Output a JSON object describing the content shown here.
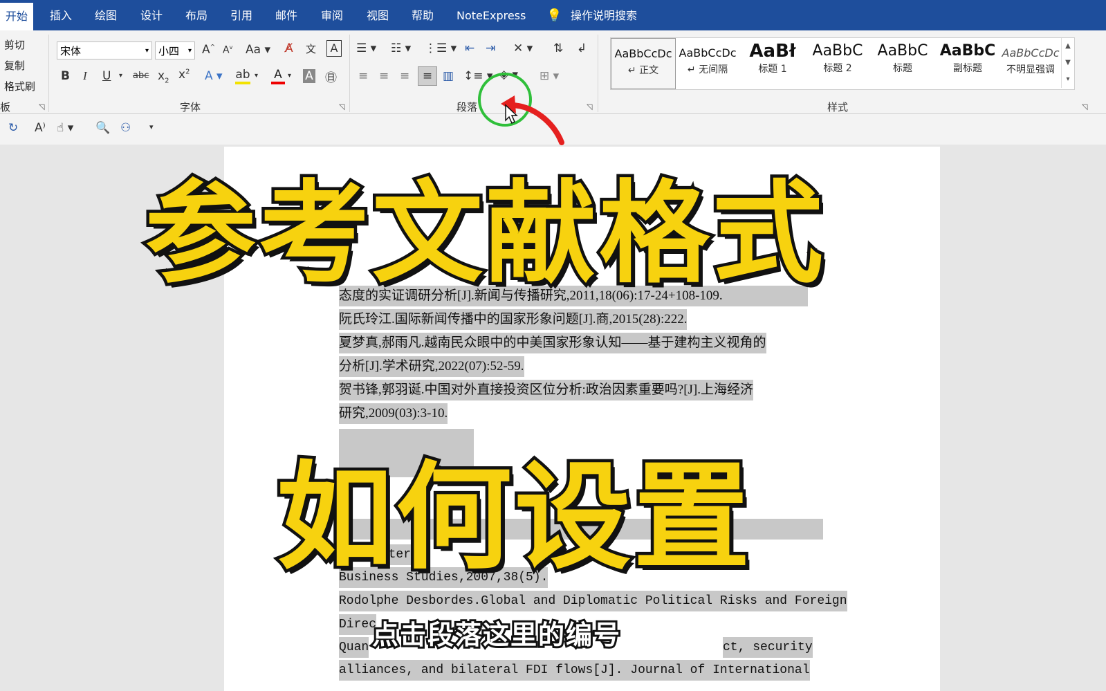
{
  "tabs": [
    "开始",
    "插入",
    "绘图",
    "设计",
    "布局",
    "引用",
    "邮件",
    "审阅",
    "视图",
    "帮助",
    "NoteExpress",
    "操作说明搜索"
  ],
  "clipboard": {
    "cut": "剪切",
    "copy": "复制",
    "format_painter": "格式刷",
    "group_label": "板"
  },
  "font": {
    "name": "宋体",
    "size": "小四",
    "group_label": "字体",
    "case_label": "Aa",
    "bold": "B",
    "italic": "I",
    "underline": "U",
    "strike": "abc"
  },
  "paragraph": {
    "group_label": "段落"
  },
  "styles": {
    "group_label": "样式",
    "items": [
      {
        "preview": "AaBbCcDc",
        "name": "↵ 正文"
      },
      {
        "preview": "AaBbCcDc",
        "name": "↵ 无间隔"
      },
      {
        "preview": "AaBł",
        "name": "标题 1"
      },
      {
        "preview": "AaBbC",
        "name": "标题 2"
      },
      {
        "preview": "AaBbC",
        "name": "标题"
      },
      {
        "preview": "AaBbC",
        "name": "副标题"
      },
      {
        "preview": "AaBbCcDc",
        "name": "不明显强调"
      }
    ]
  },
  "document": {
    "lines": [
      "态度的实证调研分析[J].新闻与传播研究,2011,18(06):17-24+108-109.",
      "阮氏玲江.国际新闻传播中的国家形象问题[J].商,2015(28):222.",
      "夏梦真,郝雨凡.越南民众眼中的中美国家形象认知——基于建构主义视角的",
      "分析[J].学术研究,2022(07):52-59.",
      "贺书锋,郭羽诞.中国对外直接投资区位分析:政治因素重要吗?[J].上海经济",
      "研究,2009(03):3-10.",
      "Business Studies,2007,38(5).",
      "Rodolphe Desbordes.Global and Diplomatic Political Risks and Foreign",
      "alliances,  and  bilateral  FDI  flows[J].  Journal  of  International"
    ],
    "fragments": [
      "Direc",
      "Quan",
      "ct,  security",
      "Inter"
    ]
  },
  "overlay": {
    "title_line1": "参考文献格式",
    "title_line2": "如何设置",
    "subtitle": "点击段落这里的编号"
  },
  "colors": {
    "tab_bar": "#1e4e9c",
    "title_fill": "#f7d20f",
    "title_stroke": "#111111",
    "highlight_circle": "#2fbf3a",
    "arrow": "#e5201f"
  }
}
